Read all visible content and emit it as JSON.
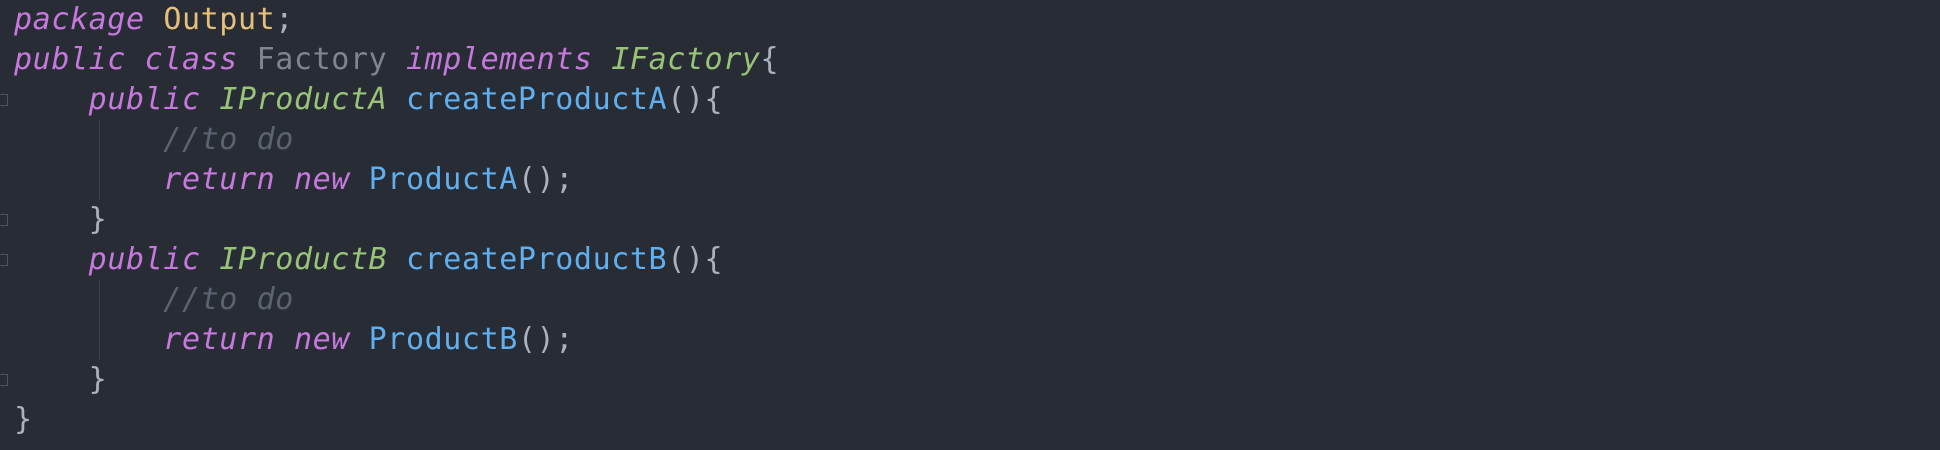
{
  "editor": {
    "lines": [
      {
        "tokens": [
          {
            "text": "package",
            "kind": "keyword"
          },
          {
            "text": " ",
            "kind": "space"
          },
          {
            "text": "Output",
            "kind": "package"
          },
          {
            "text": ";",
            "kind": "punctuation"
          }
        ]
      },
      {
        "tokens": [
          {
            "text": "public",
            "kind": "keyword"
          },
          {
            "text": " ",
            "kind": "space"
          },
          {
            "text": "class",
            "kind": "keyword"
          },
          {
            "text": " ",
            "kind": "space"
          },
          {
            "text": "Factory",
            "kind": "class"
          },
          {
            "text": " ",
            "kind": "space"
          },
          {
            "text": "implements",
            "kind": "keyword"
          },
          {
            "text": " ",
            "kind": "space"
          },
          {
            "text": "IFactory",
            "kind": "type"
          },
          {
            "text": "{",
            "kind": "punctuation"
          }
        ]
      },
      {
        "tokens": [
          {
            "text": "    ",
            "kind": "space"
          },
          {
            "text": "public",
            "kind": "keyword"
          },
          {
            "text": " ",
            "kind": "space"
          },
          {
            "text": "IProductA",
            "kind": "type"
          },
          {
            "text": " ",
            "kind": "space"
          },
          {
            "text": "createProductA",
            "kind": "function"
          },
          {
            "text": "(){",
            "kind": "punctuation"
          }
        ]
      },
      {
        "tokens": [
          {
            "text": "        ",
            "kind": "space"
          },
          {
            "text": "//to do",
            "kind": "comment"
          }
        ]
      },
      {
        "tokens": [
          {
            "text": "        ",
            "kind": "space"
          },
          {
            "text": "return",
            "kind": "keyword"
          },
          {
            "text": " ",
            "kind": "space"
          },
          {
            "text": "new",
            "kind": "keyword"
          },
          {
            "text": " ",
            "kind": "space"
          },
          {
            "text": "ProductA",
            "kind": "function"
          },
          {
            "text": "();",
            "kind": "punctuation"
          }
        ]
      },
      {
        "tokens": [
          {
            "text": "    ",
            "kind": "space"
          },
          {
            "text": "}",
            "kind": "punctuation"
          }
        ]
      },
      {
        "tokens": [
          {
            "text": "    ",
            "kind": "space"
          },
          {
            "text": "public",
            "kind": "keyword"
          },
          {
            "text": " ",
            "kind": "space"
          },
          {
            "text": "IProductB",
            "kind": "type"
          },
          {
            "text": " ",
            "kind": "space"
          },
          {
            "text": "createProductB",
            "kind": "function"
          },
          {
            "text": "(){",
            "kind": "punctuation"
          }
        ]
      },
      {
        "tokens": [
          {
            "text": "        ",
            "kind": "space"
          },
          {
            "text": "//to do",
            "kind": "comment"
          }
        ]
      },
      {
        "tokens": [
          {
            "text": "        ",
            "kind": "space"
          },
          {
            "text": "return",
            "kind": "keyword"
          },
          {
            "text": " ",
            "kind": "space"
          },
          {
            "text": "new",
            "kind": "keyword"
          },
          {
            "text": " ",
            "kind": "space"
          },
          {
            "text": "ProductB",
            "kind": "function"
          },
          {
            "text": "();",
            "kind": "punctuation"
          }
        ]
      },
      {
        "tokens": [
          {
            "text": "    ",
            "kind": "space"
          },
          {
            "text": "}",
            "kind": "punctuation"
          }
        ]
      },
      {
        "tokens": [
          {
            "text": "}",
            "kind": "punctuation"
          }
        ]
      }
    ]
  },
  "colors": {
    "background": "#282c34",
    "keyword": "#c678dd",
    "type": "#98c379",
    "package": "#e5c07b",
    "class": "#7f848e",
    "function": "#61afef",
    "comment": "#5c6370",
    "punctuation": "#abb2bf"
  }
}
